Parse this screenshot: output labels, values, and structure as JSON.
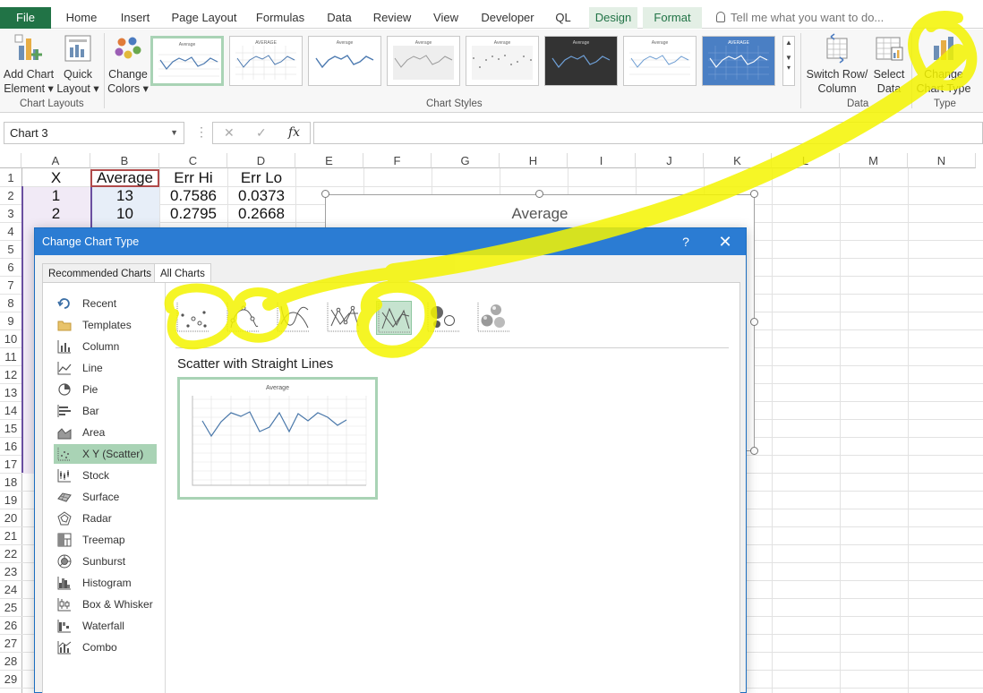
{
  "ribbon_tabs": [
    {
      "label": "File"
    },
    {
      "label": "Home"
    },
    {
      "label": "Insert"
    },
    {
      "label": "Page Layout"
    },
    {
      "label": "Formulas"
    },
    {
      "label": "Data"
    },
    {
      "label": "Review"
    },
    {
      "label": "View"
    },
    {
      "label": "Developer"
    },
    {
      "label": "QL"
    },
    {
      "label": "Design"
    },
    {
      "label": "Format"
    }
  ],
  "tell_me": {
    "placeholder": "Tell me what you want to do..."
  },
  "ribbon": {
    "add_chart_element_1": "Add Chart",
    "add_chart_element_2": "Element ▾",
    "quick_layout_1": "Quick",
    "quick_layout_2": "Layout ▾",
    "change_colors_1": "Change",
    "change_colors_2": "Colors ▾",
    "switch_row_1": "Switch Row/",
    "switch_row_2": "Column",
    "select_data_1": "Select",
    "select_data_2": "Data",
    "change_chart_type_1": "Change",
    "change_chart_type_2": "Chart Type",
    "groups": {
      "chart_layouts": "Chart Layouts",
      "chart_styles": "Chart Styles",
      "data": "Data",
      "type": "Type"
    },
    "style_thumbs": [
      {
        "title": "Average",
        "dark": false
      },
      {
        "title": "AVERAGE",
        "dark": false
      },
      {
        "title": "Average",
        "dark": false
      },
      {
        "title": "Average",
        "dark": false
      },
      {
        "title": "Average",
        "dark": false
      },
      {
        "title": "Average",
        "dark": true
      },
      {
        "title": "Average",
        "dark": false
      },
      {
        "title": "AVERAGE",
        "dark": true
      }
    ]
  },
  "formula_bar": {
    "name_box": "Chart 3",
    "cancel_icon": "✕",
    "enter_icon": "✓",
    "fx_label": "fx"
  },
  "columns": [
    "A",
    "B",
    "C",
    "D",
    "E",
    "F",
    "G",
    "H",
    "I",
    "J",
    "K",
    "L",
    "M",
    "N"
  ],
  "rows": [
    "1",
    "2",
    "3",
    "4",
    "5",
    "6",
    "7",
    "8",
    "9",
    "10",
    "11",
    "12",
    "13",
    "14",
    "15",
    "16",
    "17",
    "18",
    "19",
    "20",
    "21",
    "22",
    "23",
    "24",
    "25",
    "26",
    "27",
    "28",
    "29"
  ],
  "sheet": {
    "headers": [
      "X",
      "Average",
      "Err Hi",
      "Err Lo"
    ],
    "row2": [
      "1",
      "13",
      "0.7586",
      "0.0373"
    ],
    "row3": [
      "2",
      "10",
      "0.2795",
      "0.2668"
    ]
  },
  "chart": {
    "title": "Average"
  },
  "dialog": {
    "title": "Change Chart Type",
    "help": "?",
    "close": "✕",
    "tabs": [
      "Recommended Charts",
      "All Charts"
    ],
    "categories": [
      {
        "label": "Recent",
        "icon": "recent-icon"
      },
      {
        "label": "Templates",
        "icon": "folder-icon"
      },
      {
        "label": "Column",
        "icon": "column-chart-icon"
      },
      {
        "label": "Line",
        "icon": "line-chart-icon"
      },
      {
        "label": "Pie",
        "icon": "pie-chart-icon"
      },
      {
        "label": "Bar",
        "icon": "bar-chart-icon"
      },
      {
        "label": "Area",
        "icon": "area-chart-icon"
      },
      {
        "label": "X Y (Scatter)",
        "icon": "scatter-chart-icon"
      },
      {
        "label": "Stock",
        "icon": "stock-chart-icon"
      },
      {
        "label": "Surface",
        "icon": "surface-chart-icon"
      },
      {
        "label": "Radar",
        "icon": "radar-chart-icon"
      },
      {
        "label": "Treemap",
        "icon": "treemap-chart-icon"
      },
      {
        "label": "Sunburst",
        "icon": "sunburst-chart-icon"
      },
      {
        "label": "Histogram",
        "icon": "histogram-chart-icon"
      },
      {
        "label": "Box & Whisker",
        "icon": "box-whisker-chart-icon"
      },
      {
        "label": "Waterfall",
        "icon": "waterfall-chart-icon"
      },
      {
        "label": "Combo",
        "icon": "combo-chart-icon"
      }
    ],
    "selected_category": "X Y (Scatter)",
    "subtype_label": "Scatter with Straight Lines",
    "preview_title": "Average"
  },
  "colors": {
    "excel_green": "#217346",
    "selection_green": "#a9d3b5",
    "dialog_blue": "#2b7cd3",
    "highlighter_yellow": "#f4f400"
  }
}
